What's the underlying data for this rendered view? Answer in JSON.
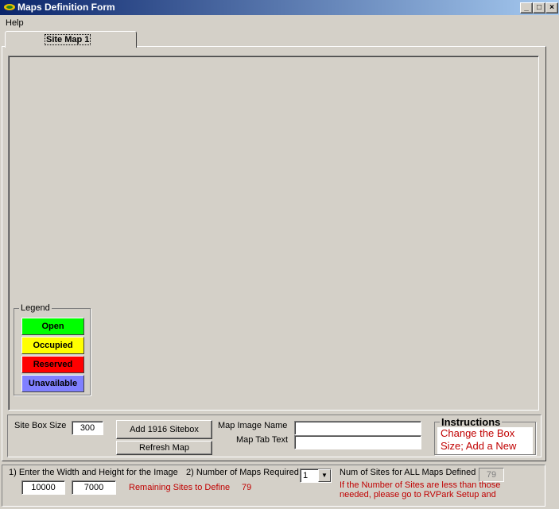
{
  "window": {
    "title": "Maps Definition Form",
    "controls": {
      "minimize": "_",
      "maximize": "□",
      "close": "×"
    }
  },
  "menu": {
    "help_label": "Help"
  },
  "tabs": [
    {
      "label": "Site Map 1"
    }
  ],
  "legend": {
    "title": "Legend",
    "items": [
      {
        "label": "Open",
        "color": "#00ff00"
      },
      {
        "label": "Occupied",
        "color": "#ffff00"
      },
      {
        "label": "Reserved",
        "color": "#ff0000"
      },
      {
        "label": "Unavailable",
        "color": "#8080ff"
      }
    ]
  },
  "site_panel": {
    "site_box_size_label": "Site Box Size",
    "site_box_size_value": "300",
    "add_sitebox_label": "Add 1916 Sitebox",
    "refresh_map_label": "Refresh Map",
    "map_image_name_label": "Map Image Name",
    "map_image_name_value": "",
    "map_tab_text_label": "Map Tab Text",
    "map_tab_text_value": ""
  },
  "instructions": {
    "title": "Instructions",
    "text": "Change the Box Size; Add a New"
  },
  "bottom": {
    "dimensions_label": "1) Enter the Width and Height for the Image",
    "width_value": "10000",
    "height_value": "7000",
    "remaining_label": "Remaining Sites to Define",
    "remaining_value": "79",
    "num_maps_label": "2) Number of Maps Required",
    "num_maps_value": "1",
    "num_sites_label": "Num of Sites for ALL Maps Defined",
    "num_sites_value": "79",
    "warning_text": "If the Number of Sites are less than those needed, please go to RVPark Setup and"
  }
}
